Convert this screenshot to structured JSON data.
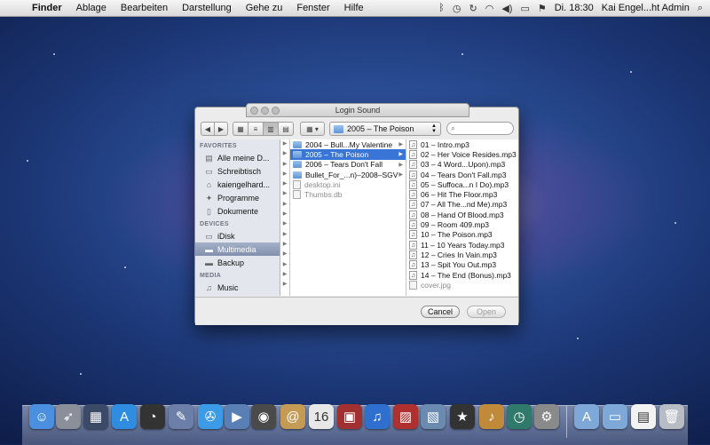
{
  "menubar": {
    "app_name": "Finder",
    "menus": [
      "Ablage",
      "Bearbeiten",
      "Darstellung",
      "Gehe zu",
      "Fenster",
      "Hilfe"
    ],
    "clock": "Di. 18:30",
    "user": "Kai Engel...ht Admin"
  },
  "dialog": {
    "title": "Login Sound",
    "path_popup": "2005 – The Poison",
    "search_placeholder": "",
    "cancel_label": "Cancel",
    "open_label": "Open"
  },
  "sidebar": {
    "favorites_header": "FAVORITES",
    "favorites": [
      {
        "label": "Alle meine D...",
        "icon": "all-files-icon"
      },
      {
        "label": "Schreibtisch",
        "icon": "desktop-icon"
      },
      {
        "label": "kaiengelhard...",
        "icon": "home-icon"
      },
      {
        "label": "Programme",
        "icon": "applications-icon"
      },
      {
        "label": "Dokumente",
        "icon": "documents-icon"
      }
    ],
    "devices_header": "DEVICES",
    "devices": [
      {
        "label": "iDisk",
        "icon": "idisk-icon"
      },
      {
        "label": "Multimedia",
        "icon": "drive-icon",
        "selected": true
      },
      {
        "label": "Backup",
        "icon": "drive-icon"
      }
    ],
    "media_header": "MEDIA",
    "media": [
      {
        "label": "Music",
        "icon": "music-icon"
      }
    ]
  },
  "column1": [
    {
      "label": "2004 – Bull...My Valentine",
      "type": "folder"
    },
    {
      "label": "2005 – The Poison",
      "type": "folder",
      "selected": true
    },
    {
      "label": "2006 – Tears Don't Fall",
      "type": "folder"
    },
    {
      "label": "Bullet_For_...n)–2008–SGV",
      "type": "folder"
    },
    {
      "label": "desktop.ini",
      "type": "file",
      "dim": true
    },
    {
      "label": "Thumbs.db",
      "type": "file",
      "dim": true
    }
  ],
  "column2": [
    {
      "label": "01 – Intro.mp3",
      "type": "mp3"
    },
    {
      "label": "02 – Her Voice Resides.mp3",
      "type": "mp3"
    },
    {
      "label": "03 – 4 Word...Upon).mp3",
      "type": "mp3"
    },
    {
      "label": "04 – Tears Don't Fall.mp3",
      "type": "mp3"
    },
    {
      "label": "05 – Suffoca...n I Do).mp3",
      "type": "mp3"
    },
    {
      "label": "06 – Hit The Floor.mp3",
      "type": "mp3"
    },
    {
      "label": "07 – All The...nd Me).mp3",
      "type": "mp3"
    },
    {
      "label": "08 – Hand Of Blood.mp3",
      "type": "mp3"
    },
    {
      "label": "09 – Room 409.mp3",
      "type": "mp3"
    },
    {
      "label": "10 – The Poison.mp3",
      "type": "mp3"
    },
    {
      "label": "11 – 10 Years Today.mp3",
      "type": "mp3"
    },
    {
      "label": "12 – Cries In Vain.mp3",
      "type": "mp3"
    },
    {
      "label": "13 – Spit You Out.mp3",
      "type": "mp3"
    },
    {
      "label": "14 – The End (Bonus).mp3",
      "type": "mp3"
    },
    {
      "label": "cover.jpg",
      "type": "file",
      "dim": true
    }
  ],
  "dock": [
    {
      "icon": "finder-icon",
      "color": "#4a8fe0"
    },
    {
      "icon": "launchpad-icon",
      "color": "#8a8f99"
    },
    {
      "icon": "mission-control-icon",
      "color": "#3b4a66"
    },
    {
      "icon": "app-store-icon",
      "color": "#2e8de0"
    },
    {
      "icon": "dashboard-icon",
      "color": "#333333"
    },
    {
      "icon": "preview-icon",
      "color": "#6c7fa8"
    },
    {
      "icon": "safari-icon",
      "color": "#3b9be6"
    },
    {
      "icon": "facetime-icon",
      "color": "#5a7fb5"
    },
    {
      "icon": "camera-icon",
      "color": "#4a4a4a"
    },
    {
      "icon": "address-book-icon",
      "color": "#c49a55"
    },
    {
      "icon": "calendar-icon",
      "color": "#e8e8e8"
    },
    {
      "icon": "photo-booth-icon",
      "color": "#a23030"
    },
    {
      "icon": "itunes-icon",
      "color": "#2f6fd0"
    },
    {
      "icon": "photo-viewer-icon",
      "color": "#b03030"
    },
    {
      "icon": "iphoto-icon",
      "color": "#6a8ab0"
    },
    {
      "icon": "imovie-icon",
      "color": "#333333"
    },
    {
      "icon": "garageband-icon",
      "color": "#c08a3a"
    },
    {
      "icon": "time-machine-icon",
      "color": "#2f7a6a"
    },
    {
      "icon": "system-preferences-icon",
      "color": "#8a8a8a"
    },
    {
      "icon": "applications-folder-icon",
      "color": "#7ea8d8"
    },
    {
      "icon": "documents-folder-icon",
      "color": "#7ea8d8"
    },
    {
      "icon": "document-icon",
      "color": "#f2f2f2"
    },
    {
      "icon": "trash-icon",
      "color": "#b8bcc4"
    }
  ]
}
